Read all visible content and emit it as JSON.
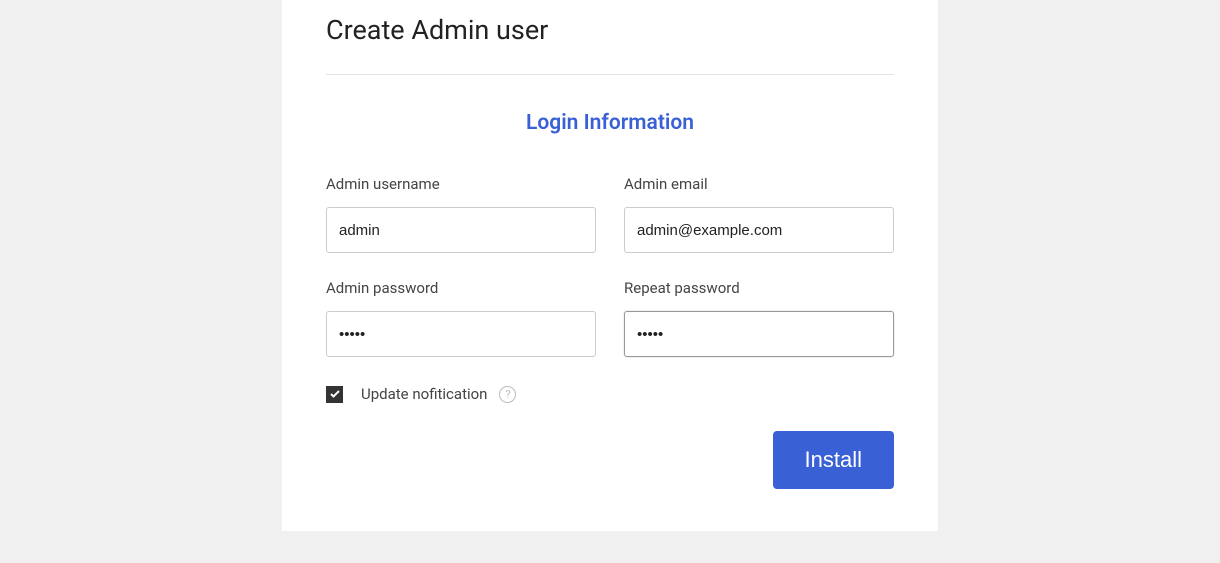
{
  "page": {
    "title": "Create Admin user",
    "section_title": "Login Information"
  },
  "fields": {
    "username": {
      "label": "Admin username",
      "value": "admin"
    },
    "email": {
      "label": "Admin email",
      "value": "admin@example.com"
    },
    "password": {
      "label": "Admin password",
      "value": "•••••"
    },
    "repeat_password": {
      "label": "Repeat password",
      "value": "•••••"
    }
  },
  "checkbox": {
    "label": "Update nofitication",
    "checked": true
  },
  "actions": {
    "install": "Install"
  }
}
